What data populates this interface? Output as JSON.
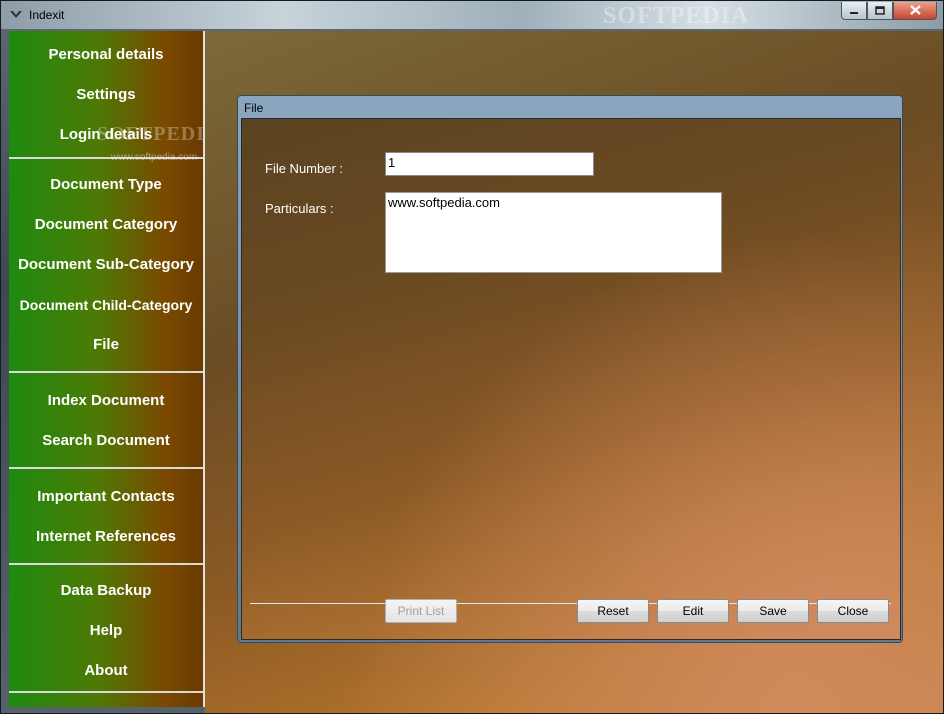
{
  "window": {
    "title": "Indexit",
    "title_watermark": "SOFTPEDIA"
  },
  "sidebar": {
    "watermark": "SOFTPEDIA",
    "watermark_url": "www.softpedia.com",
    "groups": [
      {
        "items": [
          "Personal details",
          "Settings",
          "Login details"
        ]
      },
      {
        "items": [
          "Document Type",
          "Document Category",
          "Document Sub-Category",
          "Document Child-Category",
          "File"
        ]
      },
      {
        "items": [
          "Index Document",
          "Search Document"
        ]
      },
      {
        "items": [
          "Important Contacts",
          "Internet References"
        ]
      },
      {
        "items": [
          "Data Backup",
          "Help",
          "About"
        ]
      }
    ]
  },
  "dialog": {
    "title": "File",
    "fields": {
      "file_number_label": "File Number :",
      "file_number_value": "1",
      "particulars_label": "Particulars :",
      "particulars_value": "www.softpedia.com"
    },
    "buttons": {
      "print_list": "Print List",
      "reset": "Reset",
      "edit": "Edit",
      "save": "Save",
      "close": "Close"
    }
  },
  "colors": {
    "sidebar_green": "#1f8a0f",
    "sidebar_brown": "#7a4a00",
    "dialog_frame": "#7f9bb5"
  },
  "icons": {
    "app": "app-logo-icon",
    "minimize": "minimize-icon",
    "maximize": "maximize-icon",
    "close": "close-icon"
  }
}
